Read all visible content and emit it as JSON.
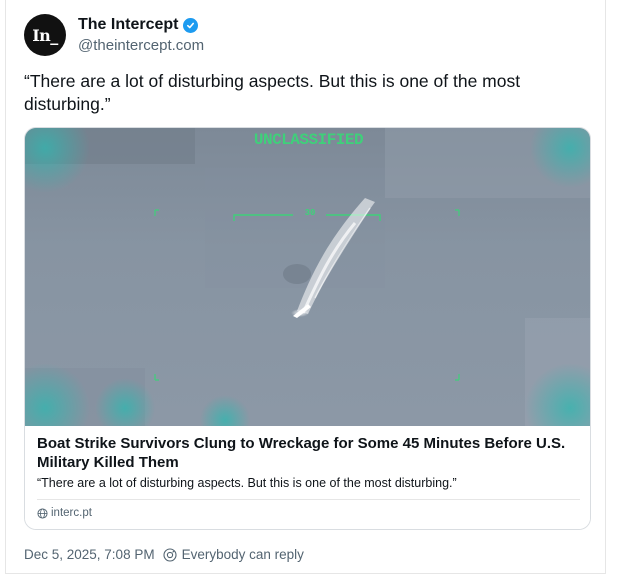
{
  "author": {
    "avatar_text": "In_",
    "display_name": "The Intercept",
    "handle": "@theintercept.com",
    "verified_icon": "verified-badge-icon"
  },
  "post": {
    "text": "“There are a lot of disturbing aspects. But this is one of the most disturbing.”"
  },
  "link_card": {
    "image_overlay": {
      "classification": "UNCLASSIFIED",
      "heading_number": "30"
    },
    "title": "Boat Strike Survivors Clung to Wreckage for Some 45 Minutes Before U.S. Military Killed Them",
    "description": "“There are a lot of disturbing aspects. But this is one of the most disturbing.”",
    "domain": "interc.pt",
    "domain_icon": "globe-icon"
  },
  "footer": {
    "timestamp": "Dec 5, 2025, 7:08 PM",
    "reply_icon": "reply-permission-icon",
    "reply_setting": "Everybody can reply"
  },
  "colors": {
    "text_primary": "#0f1419",
    "text_secondary": "#536471",
    "verified": "#1d9bf0",
    "hud_green": "#3fd07a",
    "border": "#d9dde1"
  }
}
